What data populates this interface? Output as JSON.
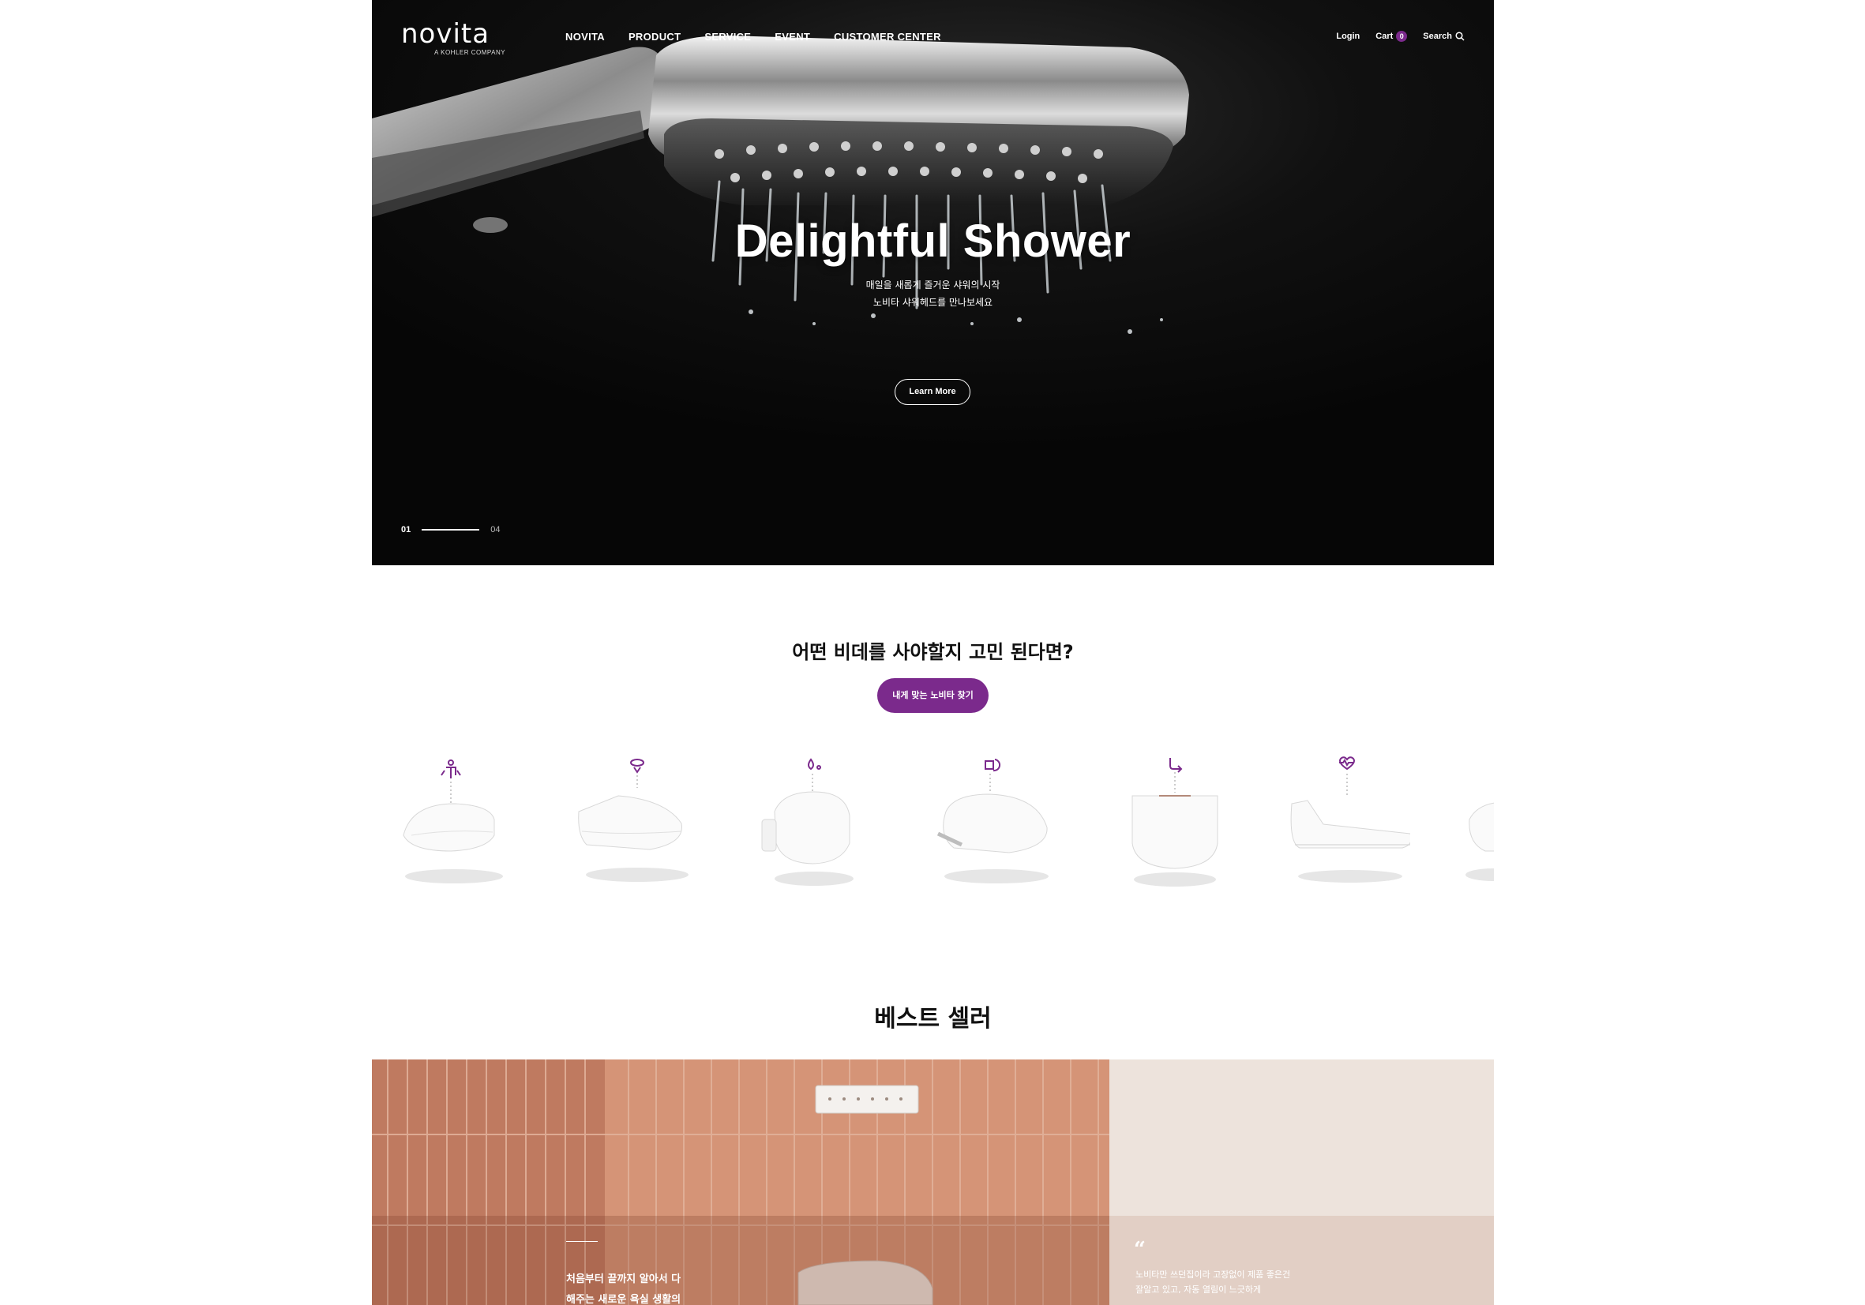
{
  "brand": {
    "logo": "novita",
    "tagline": "A KOHLER COMPANY"
  },
  "nav": {
    "items": [
      "NOVITA",
      "PRODUCT",
      "SERVICE",
      "EVENT",
      "CUSTOMER CENTER"
    ],
    "login": "Login",
    "cart_label": "Cart",
    "cart_count": "0",
    "search_label": "Search"
  },
  "hero": {
    "title": "Delightful Shower",
    "desc_line1": "매일을 새롭게 즐거운 샤워의 시작",
    "desc_line2": "노비타 샤워헤드를 만나보세요",
    "cta": "Learn More",
    "pager_current": "01",
    "pager_total": "04"
  },
  "finder": {
    "title": "어떤 비데를 사야할지 고민 된다면?",
    "button": "내게 맞는 노비타 찾기"
  },
  "bidets": [
    {
      "icon": "person-icon"
    },
    {
      "icon": "nozzle-icon"
    },
    {
      "icon": "water-drop-icon"
    },
    {
      "icon": "lock-refresh-icon"
    },
    {
      "icon": "arrow-return-icon"
    },
    {
      "icon": "heart-pulse-icon"
    },
    {
      "icon": ""
    }
  ],
  "best": {
    "title": "베스트 셀러",
    "left_line1": "처음부터 끝까지 알아서 다",
    "left_line2": "해주는 새로운 욕실 생활의",
    "quote": "“",
    "right_line1": "노비타만 쓰던집이라 고장없이 제품 좋은건",
    "right_line2": "잘알고 있고, 자동 열림이 느긋하게"
  },
  "colors": {
    "accent": "#7b2a8c",
    "tile": "#c8856a",
    "panel_right": "#ede3dc"
  }
}
